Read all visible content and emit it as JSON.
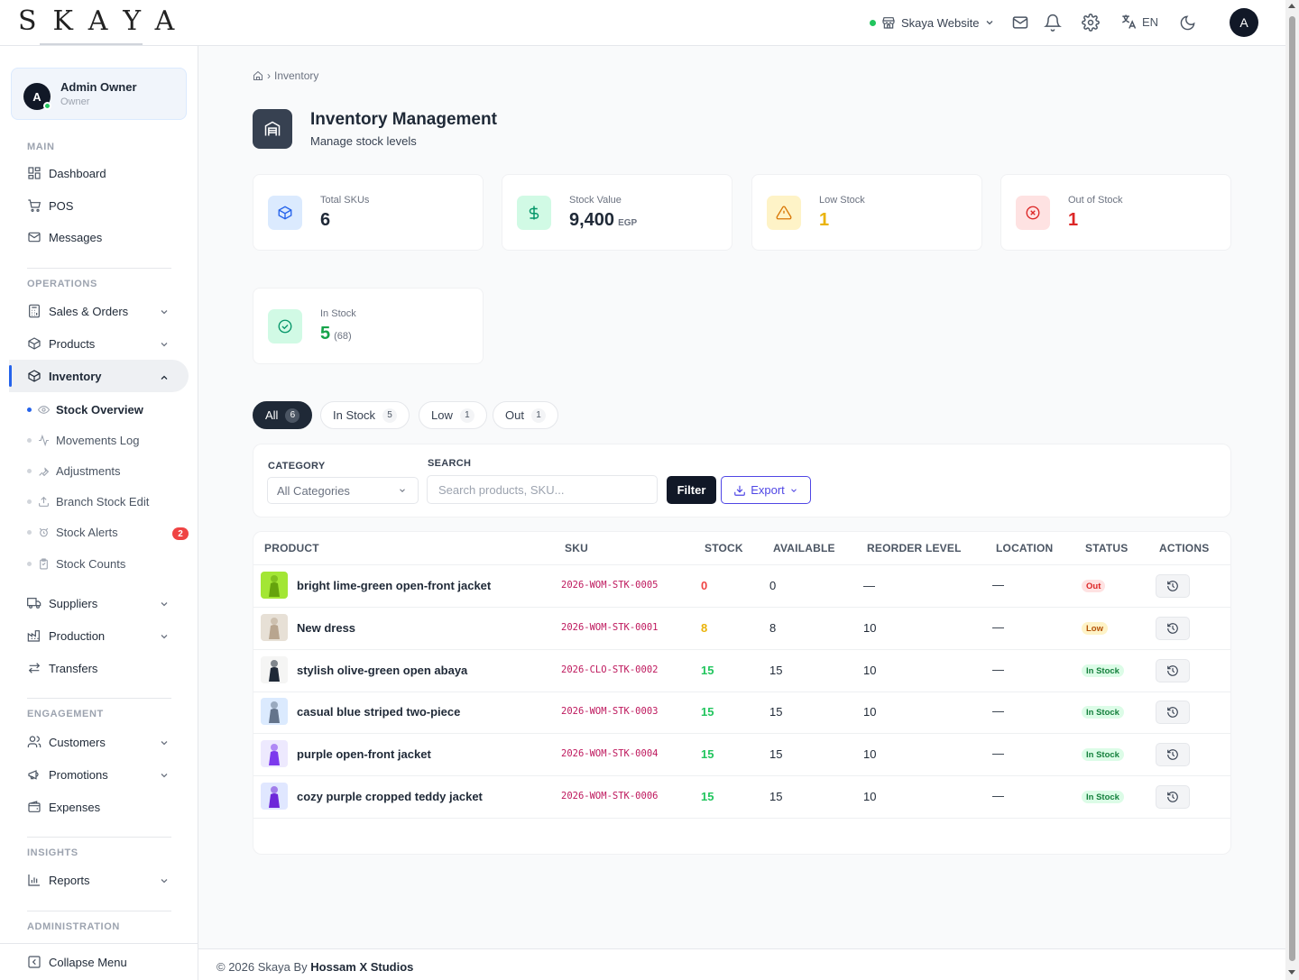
{
  "brand": {
    "logo": "SKAYA"
  },
  "topbar": {
    "site_label": "Skaya Website",
    "language": "EN",
    "avatar_initial": "A",
    "icons": [
      "store-icon",
      "mail-icon",
      "bell-icon",
      "gear-icon",
      "translate-icon",
      "moon-icon"
    ]
  },
  "user": {
    "initial": "A",
    "name": "Admin Owner",
    "role": "Owner"
  },
  "sidebar": {
    "sections": {
      "main": "MAIN",
      "operations": "OPERATIONS",
      "engagement": "ENGAGEMENT",
      "insights": "INSIGHTS",
      "administration": "ADMINISTRATION"
    },
    "items": {
      "dashboard": "Dashboard",
      "pos": "POS",
      "messages": "Messages",
      "sales_orders": "Sales & Orders",
      "products": "Products",
      "inventory": "Inventory",
      "suppliers": "Suppliers",
      "production": "Production",
      "transfers": "Transfers",
      "customers": "Customers",
      "promotions": "Promotions",
      "expenses": "Expenses",
      "reports": "Reports",
      "collapse": "Collapse Menu"
    },
    "inventory_sub": {
      "stock_overview": "Stock Overview",
      "movements_log": "Movements Log",
      "adjustments": "Adjustments",
      "branch_stock_edit": "Branch Stock Edit",
      "stock_alerts": "Stock Alerts",
      "stock_alerts_badge": "2",
      "stock_counts": "Stock Counts"
    }
  },
  "breadcrumb": {
    "current": "Inventory"
  },
  "page": {
    "title": "Inventory Management",
    "subtitle": "Manage stock levels"
  },
  "stats": {
    "total_skus": {
      "label": "Total SKUs",
      "value": "6"
    },
    "stock_value": {
      "label": "Stock Value",
      "value": "9,400",
      "unit": "EGP"
    },
    "low_stock": {
      "label": "Low Stock",
      "value": "1"
    },
    "out_of_stock": {
      "label": "Out of Stock",
      "value": "1"
    },
    "in_stock": {
      "label": "In Stock",
      "value": "5",
      "extra": "(68)"
    }
  },
  "tabs": [
    {
      "label": "All",
      "count": "6"
    },
    {
      "label": "In Stock",
      "count": "5"
    },
    {
      "label": "Low",
      "count": "1"
    },
    {
      "label": "Out",
      "count": "1"
    }
  ],
  "filters": {
    "category_label": "CATEGORY",
    "category_value": "All Categories",
    "search_label": "SEARCH",
    "search_placeholder": "Search products, SKU...",
    "filter_button": "Filter",
    "export_button": "Export"
  },
  "table": {
    "headers": [
      "PRODUCT",
      "SKU",
      "STOCK",
      "AVAILABLE",
      "REORDER LEVEL",
      "LOCATION",
      "STATUS",
      "ACTIONS"
    ],
    "rows": [
      {
        "product": "bright lime-green open-front jacket",
        "sku": "2026-WOM-STK-0005",
        "stock": "0",
        "available": "0",
        "reorder": "—",
        "location": "—",
        "status": "Out"
      },
      {
        "product": "New dress",
        "sku": "2026-WOM-STK-0001",
        "stock": "8",
        "available": "8",
        "reorder": "10",
        "location": "—",
        "status": "Low"
      },
      {
        "product": "stylish olive-green open abaya",
        "sku": "2026-CLO-STK-0002",
        "stock": "15",
        "available": "15",
        "reorder": "10",
        "location": "—",
        "status": "In Stock"
      },
      {
        "product": "casual blue striped two-piece",
        "sku": "2026-WOM-STK-0003",
        "stock": "15",
        "available": "15",
        "reorder": "10",
        "location": "—",
        "status": "In Stock"
      },
      {
        "product": "purple open-front jacket",
        "sku": "2026-WOM-STK-0004",
        "stock": "15",
        "available": "15",
        "reorder": "10",
        "location": "—",
        "status": "In Stock"
      },
      {
        "product": "cozy purple cropped teddy jacket",
        "sku": "2026-WOM-STK-0006",
        "stock": "15",
        "available": "15",
        "reorder": "10",
        "location": "—",
        "status": "In Stock"
      }
    ]
  },
  "footer": {
    "prefix": "© 2026 Skaya By",
    "studio": "Hossam X Studios"
  },
  "colors": {
    "accent": "#2563eb",
    "dark": "#111827",
    "green": "#22c55e",
    "amber": "#eab308",
    "red": "#ef4444",
    "indigo": "#4f46e5"
  }
}
